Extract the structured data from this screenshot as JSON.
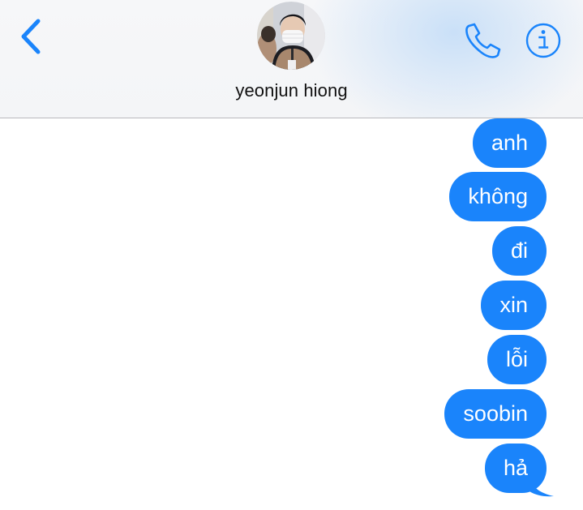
{
  "header": {
    "back_icon": "chevron-left-icon",
    "contact_name": "yeonjun hiong",
    "call_icon": "phone-icon",
    "info_icon": "info-icon"
  },
  "messages": [
    {
      "text": "anh",
      "sender": "me"
    },
    {
      "text": "không",
      "sender": "me"
    },
    {
      "text": "đi",
      "sender": "me"
    },
    {
      "text": "xin",
      "sender": "me"
    },
    {
      "text": "lỗi",
      "sender": "me"
    },
    {
      "text": "soobin",
      "sender": "me"
    },
    {
      "text": "hả",
      "sender": "me"
    }
  ],
  "colors": {
    "accent": "#1a84fb",
    "bubble_text": "#ffffff",
    "header_bg": "#f5f6f8",
    "divider": "#b9b9bd"
  }
}
